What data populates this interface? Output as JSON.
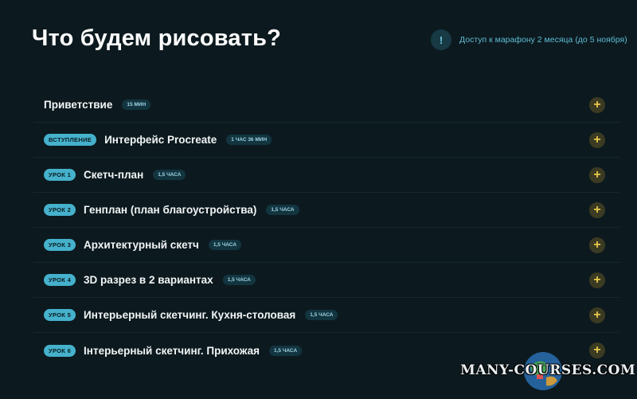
{
  "page": {
    "title": "Что будем рисовать?",
    "info_icon": "!",
    "info_text": "Доступ к марафону 2 месяца (до 5 ноября)"
  },
  "lessons": [
    {
      "tag": "",
      "title": "Приветствие",
      "duration": "15 мин"
    },
    {
      "tag": "Вступление",
      "title": "Интерфейс Procreate",
      "duration": "1 час 36 мин"
    },
    {
      "tag": "Урок 1",
      "title": "Скетч-план",
      "duration": "1,5 часа"
    },
    {
      "tag": "Урок 2",
      "title": "Генплан (план благоустройства)",
      "duration": "1,5 часа"
    },
    {
      "tag": "Урок 3",
      "title": "Архитектурный скетч",
      "duration": "1,5 часа"
    },
    {
      "tag": "Урок 4",
      "title": "3D разрез в 2 вариантах",
      "duration": "1,5 часа"
    },
    {
      "tag": "Урок 5",
      "title": "Интерьерный скетчинг. Кухня-столовая",
      "duration": "1,5 часа"
    },
    {
      "tag": "Урок 6",
      "title": "Інтерьерный скетчинг. Прихожая",
      "duration": "1,5 часа"
    }
  ],
  "expand_symbol": "+",
  "watermark": "MANY-COURSES.COM",
  "colors": {
    "background": "#0c1a1f",
    "tag_bg": "#45b1cc",
    "duration_bg": "#123540",
    "accent_yellow": "#e6c84a",
    "info_text": "#5fbcd4"
  }
}
